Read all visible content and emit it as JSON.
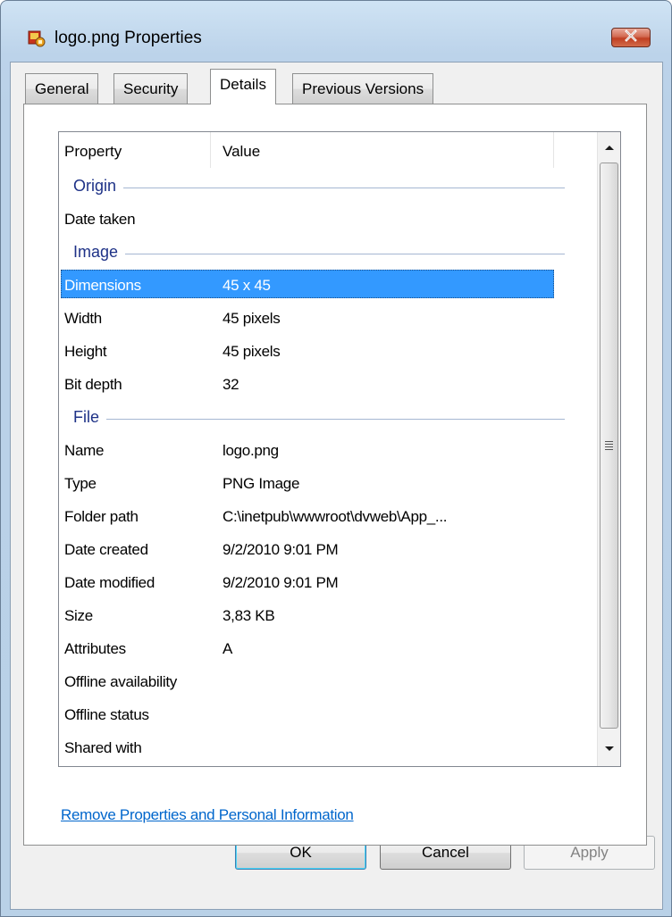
{
  "window": {
    "title": "logo.png Properties"
  },
  "tabs": [
    {
      "label": "General"
    },
    {
      "label": "Security"
    },
    {
      "label": "Details"
    },
    {
      "label": "Previous Versions"
    }
  ],
  "list": {
    "headers": {
      "property": "Property",
      "value": "Value"
    },
    "groups": {
      "origin": {
        "title": "Origin",
        "rows": [
          {
            "property": "Date taken",
            "value": ""
          }
        ]
      },
      "image": {
        "title": "Image",
        "rows": [
          {
            "property": "Dimensions",
            "value": "45 x 45",
            "selected": true
          },
          {
            "property": "Width",
            "value": "45 pixels"
          },
          {
            "property": "Height",
            "value": "45 pixels"
          },
          {
            "property": "Bit depth",
            "value": "32"
          }
        ]
      },
      "file": {
        "title": "File",
        "rows": [
          {
            "property": "Name",
            "value": "logo.png"
          },
          {
            "property": "Type",
            "value": "PNG Image"
          },
          {
            "property": "Folder path",
            "value": "C:\\inetpub\\wwwroot\\dvweb\\App_..."
          },
          {
            "property": "Date created",
            "value": "9/2/2010 9:01 PM"
          },
          {
            "property": "Date modified",
            "value": "9/2/2010 9:01 PM"
          },
          {
            "property": "Size",
            "value": "3,83 KB"
          },
          {
            "property": "Attributes",
            "value": "A"
          },
          {
            "property": "Offline availability",
            "value": ""
          },
          {
            "property": "Offline status",
            "value": ""
          },
          {
            "property": "Shared with",
            "value": ""
          }
        ]
      }
    }
  },
  "links": {
    "remove_properties": "Remove Properties and Personal Information"
  },
  "buttons": {
    "ok": "OK",
    "cancel": "Cancel",
    "apply": "Apply"
  },
  "colors": {
    "selection": "#3399ff",
    "group_title": "#1e3287",
    "link": "#0066cc",
    "close_button": "#c03f22"
  },
  "icons": {
    "app": "image-file-icon",
    "close": "close-icon",
    "scroll_up": "scroll-up-arrow-icon",
    "scroll_down": "scroll-down-arrow-icon"
  }
}
